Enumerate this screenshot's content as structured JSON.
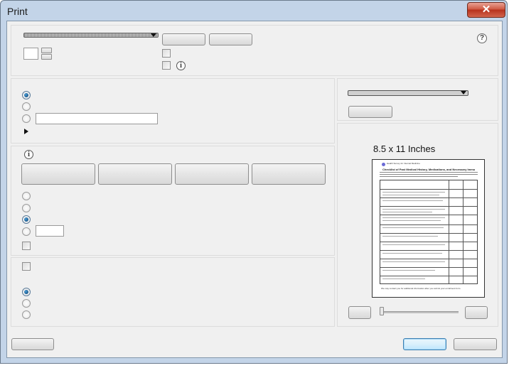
{
  "window": {
    "title": "Print",
    "close_glyph": "✕"
  },
  "preview": {
    "paper_size": "8.5 x 11 Inches",
    "doc_title": "Health Survey for Internal Medicine",
    "doc_heading": "Checklist of Past Medical History, Medications, and Necessary Immunizations",
    "doc_footer": "We may contact you for additional information after you submit your enrollment form."
  },
  "icons": {
    "info": "i",
    "help": "?"
  },
  "colors": {
    "title_bar": "#c3d4e8",
    "close": "#c8452e",
    "client": "#f0f0f0",
    "primary_button": "#bee6fd"
  }
}
